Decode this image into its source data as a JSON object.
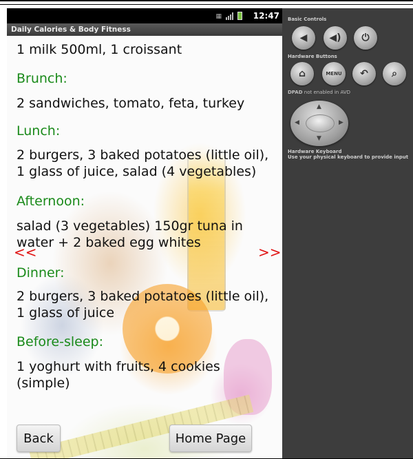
{
  "status_bar": {
    "time": "12:47"
  },
  "app": {
    "title": "Daily Calories & Body Fitness"
  },
  "meals": {
    "breakfast_text": "1 milk 500ml, 1 croissant",
    "brunch_heading": "Brunch:",
    "brunch_line1": "2 sandwiches, tomato, feta, turkey",
    "lunch_heading": "Lunch:",
    "lunch_line1": "2 burgers, 3 baked potatoes (little oil),",
    "lunch_line2": "1 glass of juice, salad (4 vegetables)",
    "afternoon_heading": "Afternoon:",
    "afternoon_line1": "salad (3 vegetables) 150gr tuna in",
    "afternoon_line2": "water + 2 baked egg whites",
    "dinner_heading": "Dinner:",
    "dinner_line1": "2 burgers, 3 baked potatoes (little oil),",
    "dinner_line2": "1 glass of juice",
    "beforesleep_heading": "Before-sleep:",
    "beforesleep_line1": "1 yoghurt with fruits, 4 cookies",
    "beforesleep_line2": "(simple)"
  },
  "nav": {
    "prev": "<<",
    "next": ">>"
  },
  "buttons": {
    "back": "Back",
    "home": "Home Page"
  },
  "emulator": {
    "basic_controls": "Basic Controls",
    "hardware_buttons": "Hardware Buttons",
    "menu_label": "MENU",
    "dpad_note_bold": "DPAD",
    "dpad_note": " not enabled in AVD",
    "keyboard_title": "Hardware Keyboard",
    "keyboard_note": "Use your physical keyboard to provide input"
  },
  "colors": {
    "heading_green": "#1a8a1a",
    "arrow_red": "#e01010",
    "panel_bg": "#3d3d3d"
  },
  "icons": [
    "volume-down-icon",
    "volume-up-icon",
    "power-icon",
    "home-icon",
    "back-icon",
    "search-icon",
    "signal-icon",
    "battery-icon"
  ]
}
